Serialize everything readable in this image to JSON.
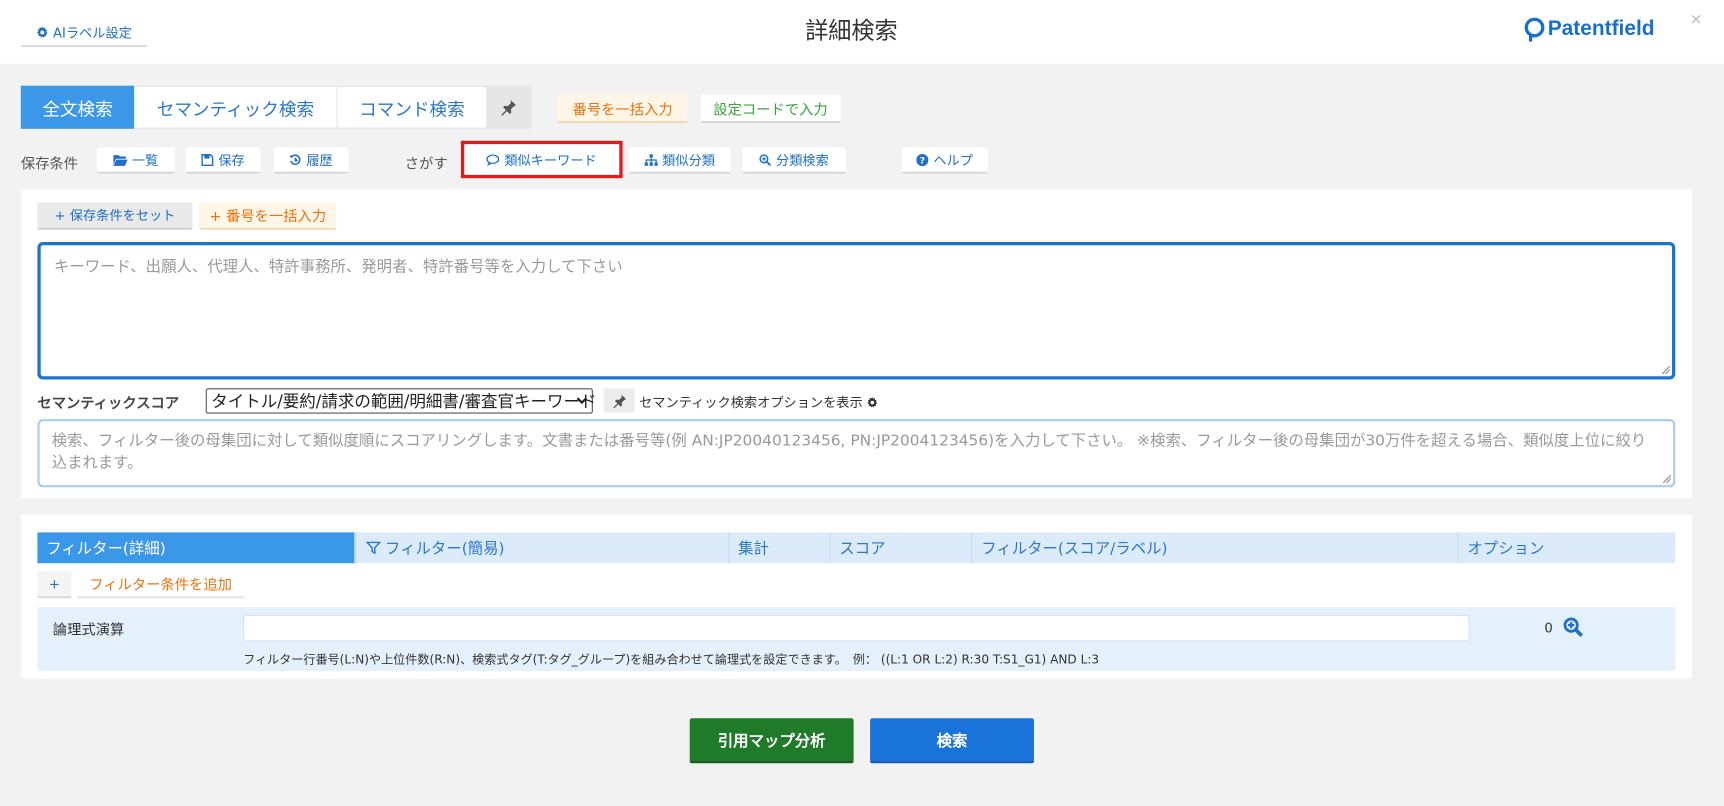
{
  "header": {
    "ai_label_settings": "AIラベル設定",
    "title": "詳細検索",
    "logo_text": "Patentfield",
    "close": "×"
  },
  "tabs": [
    {
      "label": "全文検索",
      "active": true
    },
    {
      "label": "セマンティック検索",
      "active": false
    },
    {
      "label": "コマンド検索",
      "active": false
    }
  ],
  "top_actions": {
    "bulk_number_input": "番号を一括入力",
    "settings_code_input": "設定コードで入力"
  },
  "saved_conditions": {
    "label": "保存条件",
    "list": "一覧",
    "save": "保存",
    "history": "履歴"
  },
  "search_tools": {
    "label": "さがす",
    "similar_keyword": "類似キーワード",
    "similar_classification": "類似分類",
    "classification_search": "分類検索",
    "help": "ヘルプ"
  },
  "search_panel": {
    "set_saved_condition": "+ 保存条件をセット",
    "bulk_number_input": "+ 番号を一括入力",
    "keyword_placeholder": "キーワード、出願人、代理人、特許事務所、発明者、特許番号等を入力して下さい",
    "semantic_score_label": "セマンティックスコア",
    "semantic_select_value": "タイトル/要約/請求の範囲/明細書/審査官キーワード",
    "semantic_options_toggle": "セマンティック検索オプションを表示",
    "semantic_placeholder": "検索、フィルター後の母集団に対して類似度順にスコアリングします。文書または番号等(例 AN:JP20040123456, PN:JP2004123456)を入力して下さい。 ※検索、フィルター後の母集団が30万件を超える場合、類似度上位に絞り込まれます。"
  },
  "filter_tabs": [
    {
      "label": "フィルター(詳細)",
      "active": true
    },
    {
      "label": "フィルター(簡易)",
      "active": false
    },
    {
      "label": "集計",
      "active": false
    },
    {
      "label": "スコア",
      "active": false
    },
    {
      "label": "フィルター(スコア/ラベル)",
      "active": false
    },
    {
      "label": "オプション",
      "active": false
    }
  ],
  "filter_panel": {
    "add_plus": "+",
    "add_condition": "フィルター条件を追加",
    "logic_label": "論理式演算",
    "logic_value": "",
    "count": "0",
    "logic_hint": "フィルター行番号(L:N)や上位件数(R:N)、検索式タグ(T:タグ_グループ)を組み合わせて論理式を設定できます。　例：  ((L:1 OR L:2) R:30 T:S1_G1) AND L:3"
  },
  "footer": {
    "citation_map": "引用マップ分析",
    "search": "検索"
  },
  "colors": {
    "accent_blue": "#3b98e8",
    "link_blue": "#1e6fc6",
    "orange": "#e8730f",
    "green": "#3aa33a",
    "highlight_red": "#e01b1b",
    "citation_green": "#1f7a2a",
    "search_blue": "#1a73d9"
  }
}
